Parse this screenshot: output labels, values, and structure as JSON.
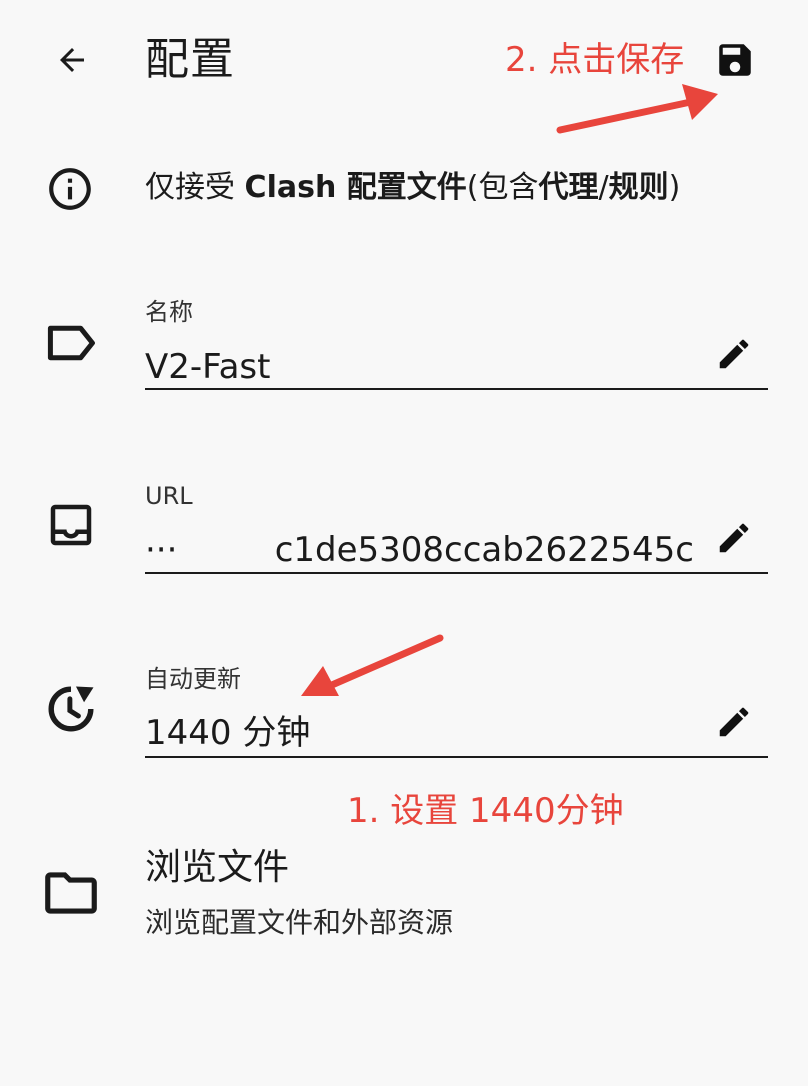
{
  "header": {
    "title": "配置",
    "back_icon": "arrow-back-icon",
    "save_icon": "save-icon"
  },
  "info": {
    "icon": "info-icon",
    "text_parts": [
      "仅接受 ",
      "Clash 配置文件",
      "(包含",
      "代理",
      "/",
      "规则",
      ")"
    ]
  },
  "fields": {
    "name": {
      "label": "名称",
      "value": "V2-Fast",
      "icon": "label-tag-icon"
    },
    "url": {
      "label": "URL",
      "value": "···         c1de5308ccab2622545c",
      "icon": "inbox-icon"
    },
    "auto_update": {
      "label": "自动更新",
      "value": "1440 分钟",
      "icon": "update-history-icon"
    }
  },
  "browse": {
    "title": "浏览文件",
    "subtitle": "浏览配置文件和外部资源",
    "icon": "folder-icon"
  },
  "annotations": {
    "step1": "1. 设置 1440分钟",
    "step2": "2. 点击保存",
    "color": "#e8453c"
  }
}
